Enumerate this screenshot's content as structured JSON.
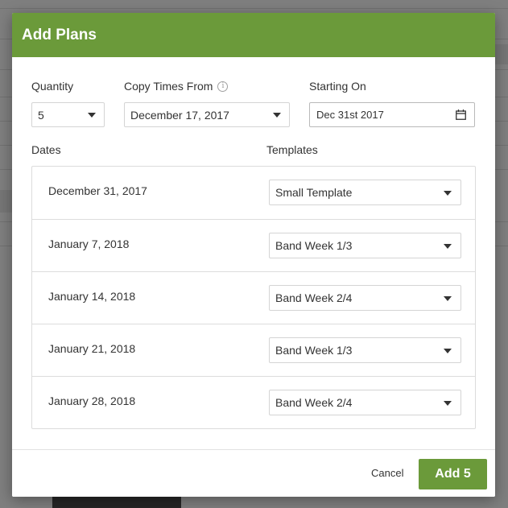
{
  "dialog": {
    "title": "Add Plans"
  },
  "fields": {
    "quantity": {
      "label": "Quantity",
      "value": "5"
    },
    "copy_times": {
      "label": "Copy Times From",
      "value": "December 17, 2017",
      "info_icon": "info-icon"
    },
    "starting_on": {
      "label": "Starting On",
      "value": "Dec 31st 2017",
      "icon": "calendar-icon"
    }
  },
  "columns": {
    "dates": "Dates",
    "templates": "Templates"
  },
  "rows": [
    {
      "date": "December 31, 2017",
      "template": "Small Template"
    },
    {
      "date": "January 7, 2018",
      "template": "Band Week 1/3"
    },
    {
      "date": "January 14, 2018",
      "template": "Band Week 2/4"
    },
    {
      "date": "January 21, 2018",
      "template": "Band Week 1/3"
    },
    {
      "date": "January 28, 2018",
      "template": "Band Week 2/4"
    }
  ],
  "footer": {
    "cancel_label": "Cancel",
    "add_label": "Add 5"
  },
  "colors": {
    "brand_green": "#6b9a3a"
  }
}
